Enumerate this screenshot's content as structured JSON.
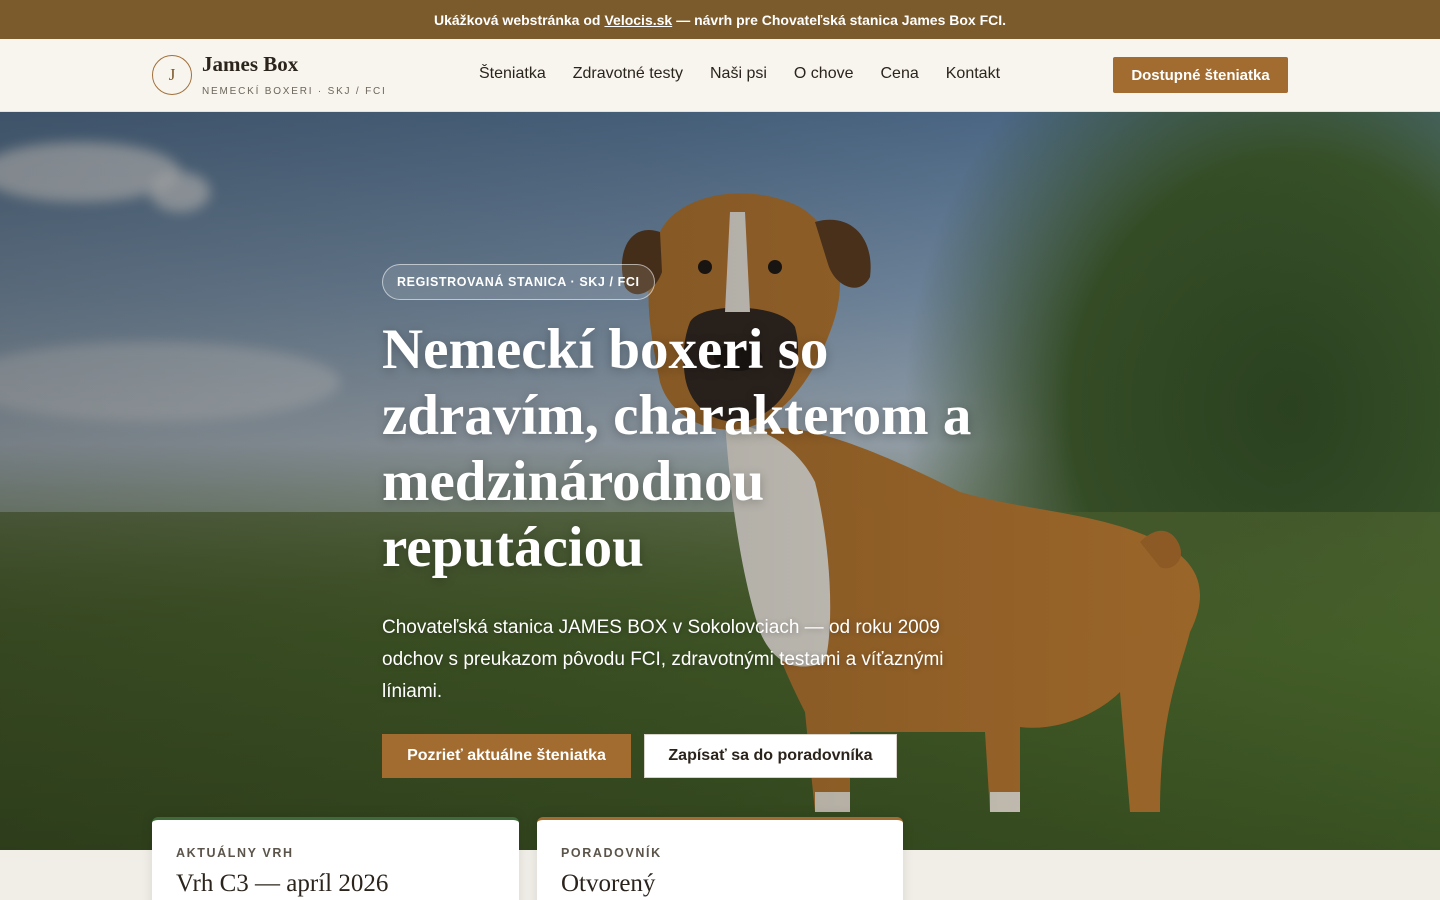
{
  "announcement": {
    "prefix": "Ukážková webstránka od",
    "link": "Velocis.sk",
    "suffix": "— návrh pre Chovateľská stanica James Box FCI."
  },
  "header": {
    "logo_letter": "J",
    "brand_name": "James Box",
    "brand_sub": "NEMECKÍ BOXERI · SKJ / FCI",
    "nav": [
      "Šteniatka",
      "Zdravotné testy",
      "Naši psi",
      "O chove",
      "Cena",
      "Kontakt"
    ],
    "cta": "Dostupné šteniatka"
  },
  "hero": {
    "badge": "REGISTROVANÁ STANICA · SKJ / FCI",
    "title": "Nemeckí boxeri so zdravím, charakterom a medzinárodnou reputáciou",
    "text": "Chovateľská stanica JAMES BOX v Sokolovciach — od roku 2009 odchov s preukazom pôvodu FCI, zdravotnými testami a víťaznými líniami.",
    "primary_button": "Pozrieť aktuálne šteniatka",
    "secondary_button": "Zapísať sa do poradovníka"
  },
  "cards": [
    {
      "kicker": "AKTUÁLNY VRH",
      "title": "Vrh C3 — apríl 2026"
    },
    {
      "kicker": "PORADOVNÍK",
      "title": "Otvorený"
    }
  ],
  "colors": {
    "brand_brown": "#7b5a2b",
    "accent": "#a26b2f",
    "green_accent": "#3f6b3a",
    "header_bg": "#f8f5ee"
  }
}
